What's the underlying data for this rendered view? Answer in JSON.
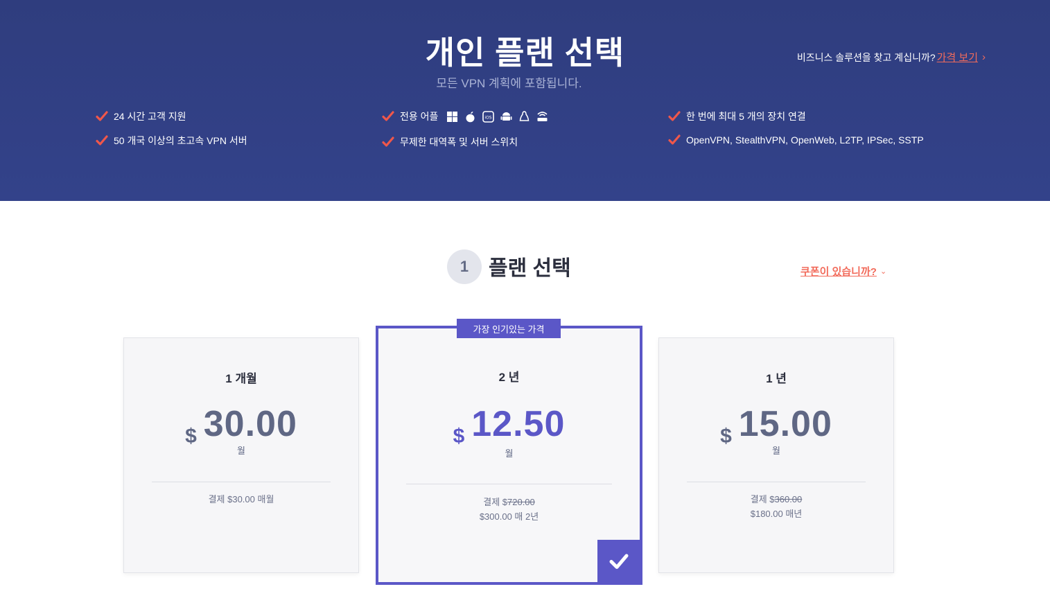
{
  "hero": {
    "title": "개인 플랜 선택",
    "subtitle": "모든 VPN 계획에 포함됩니다.",
    "business_prompt": "비즈니스 솔루션을 찾고 계십니까?",
    "business_link": "가격 보기",
    "features_col1": [
      "24 시간 고객 지원",
      "50 개국 이상의 초고속 VPN 서버"
    ],
    "features_col2": [
      "전용 어플",
      "무제한 대역폭 및 서버 스위치"
    ],
    "features_col3": [
      "한 번에 최대 5 개의 장치 연결",
      "OpenVPN, StealthVPN, OpenWeb, L2TP, IPSec, SSTP"
    ],
    "platform_icons": [
      "windows-icon",
      "apple-icon",
      "ios-icon",
      "android-icon",
      "linux-icon",
      "router-icon"
    ]
  },
  "step": {
    "number": "1",
    "title": "플랜 선택",
    "coupon_label": "쿠폰이 있습니까?"
  },
  "plans": [
    {
      "period": "1 개월",
      "currency": "$",
      "amount": "30.00",
      "per": "월",
      "billing_prefix": "결제 $30.00 매월",
      "featured": false
    },
    {
      "period": "2 년",
      "currency": "$",
      "amount": "12.50",
      "per": "월",
      "billing_prefix": "결제 $",
      "billing_strike": "720.00",
      "billing_line2": "$300.00 매 2년",
      "featured": true,
      "badge": "가장 인기있는 가격",
      "selected": true
    },
    {
      "period": "1 년",
      "currency": "$",
      "amount": "15.00",
      "per": "월",
      "billing_prefix": "결제 $",
      "billing_strike": "360.00",
      "billing_line2": "$180.00 매년",
      "featured": false
    }
  ],
  "colors": {
    "hero_bg": "#2f3d7e",
    "accent_coral": "#f26b5b",
    "accent_purple": "#5b57c7",
    "price_gray": "#5f6784"
  }
}
